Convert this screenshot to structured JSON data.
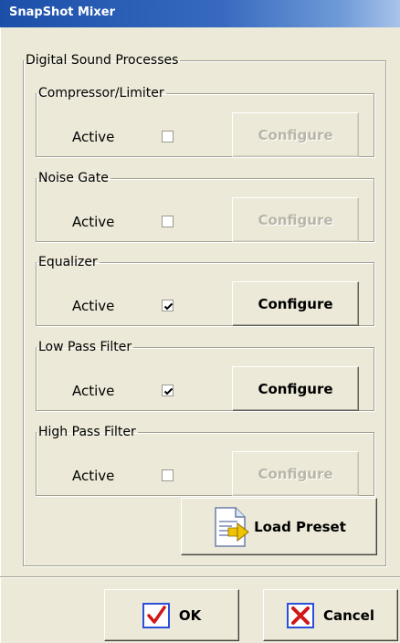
{
  "window": {
    "title": "SnapShot Mixer"
  },
  "group": {
    "label": "Digital Sound Processes"
  },
  "processes": [
    {
      "name": "Compressor/Limiter",
      "active_label": "Active",
      "active": false,
      "configure_label": "Configure",
      "configure_enabled": false
    },
    {
      "name": "Noise Gate",
      "active_label": "Active",
      "active": false,
      "configure_label": "Configure",
      "configure_enabled": false
    },
    {
      "name": "Equalizer",
      "active_label": "Active",
      "active": true,
      "configure_label": "Configure",
      "configure_enabled": true
    },
    {
      "name": "Low Pass Filter",
      "active_label": "Active",
      "active": true,
      "configure_label": "Configure",
      "configure_enabled": true
    },
    {
      "name": "High Pass Filter",
      "active_label": "Active",
      "active": false,
      "configure_label": "Configure",
      "configure_enabled": false
    }
  ],
  "load_preset": {
    "label": "Load Preset",
    "icon": "load-preset-icon"
  },
  "ok": {
    "label": "OK",
    "icon": "checkmark-icon"
  },
  "cancel": {
    "label": "Cancel",
    "icon": "x-icon"
  },
  "colors": {
    "title_bar": "#1c4fa8",
    "dialog_bg": "#ece9d8",
    "ok_icon": "#2a4fd8",
    "cancel_icon": "#d01818"
  }
}
